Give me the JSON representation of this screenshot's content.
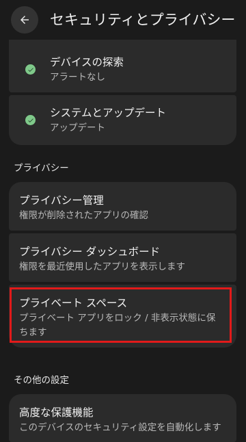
{
  "header": {
    "title": "セキュリティとプライバシー",
    "back_icon": "arrow-left-icon"
  },
  "security_items": [
    {
      "title": "デバイスの探索",
      "subtitle": "アラートなし",
      "icon": "check-circle-icon"
    },
    {
      "title": "システムとアップデート",
      "subtitle": "アップデート",
      "icon": "check-circle-icon"
    }
  ],
  "sections": {
    "privacy": "プライバシー",
    "other": "その他の設定"
  },
  "privacy_items": [
    {
      "title": "プライバシー管理",
      "subtitle": "権限が削除されたアプリの確認"
    },
    {
      "title": "プライバシー ダッシュボード",
      "subtitle": "権限を最近使用したアプリを表示します"
    },
    {
      "title": "プライベート スペース",
      "subtitle": "プライベート アプリをロック / 非表示状態に保ちます"
    }
  ],
  "other_items": [
    {
      "title": "高度な保護機能",
      "subtitle": "このデバイスのセキュリティ設定を自動化します"
    }
  ],
  "colors": {
    "background": "#1b1b1b",
    "card": "#2b2b2b",
    "check": "#7fc98a",
    "highlight": "#e21a1a"
  }
}
